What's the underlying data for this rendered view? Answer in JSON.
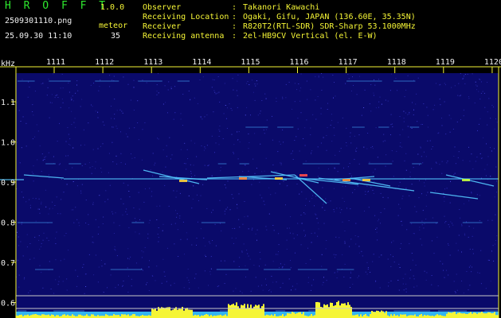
{
  "app": {
    "title": "H R O F F T",
    "version": "1.0.0"
  },
  "file": {
    "name": "2509301110.png",
    "datetime": "25.09.30 11:10"
  },
  "meteor": {
    "label": "meteor",
    "count": "35"
  },
  "info": [
    {
      "label": "Observer",
      "value": "Takanori Kawachi"
    },
    {
      "label": "Receiving Location",
      "value": "Ogaki, Gifu, JAPAN (136.60E, 35.35N)"
    },
    {
      "label": "Receiver",
      "value": "R820T2(RTL-SDR) SDR-Sharp 53.1000MHz"
    },
    {
      "label": "Receiving antenna",
      "value": "2el-HB9CV Vertical (el. E-W)"
    }
  ],
  "spectrogram": {
    "unit_label": "kHz",
    "separator": ":",
    "time_ticks": [
      "1111",
      "1112",
      "1113",
      "1114",
      "1115",
      "1116",
      "1117",
      "1118",
      "1119",
      "1120"
    ],
    "freq_ticks": [
      "1.1",
      "1.0",
      "0.9",
      "0.8",
      "0.7",
      "0.6"
    ],
    "colors": {
      "background": "#0a0a6a",
      "noise": "#3a3ad0",
      "trace": "#55c8ff",
      "axis": "#f5f536",
      "bar": "#f5f536",
      "floor": "#37c8ff"
    }
  }
}
